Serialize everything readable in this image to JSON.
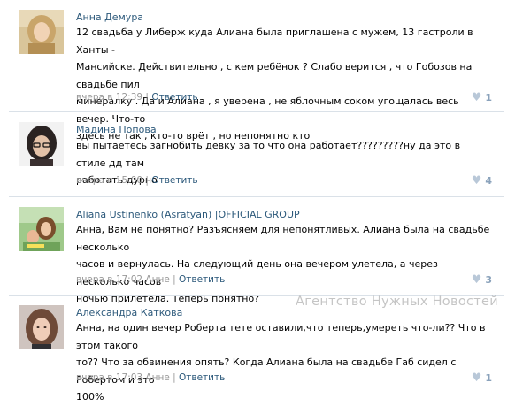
{
  "comments": [
    {
      "author": "Анна Демура",
      "lines": [
        "12 свадьба у Либерж куда Алиана была приглашена с мужем, 13 гастроли в Ханты -",
        "Мансийске. Действительно , с кем ребёнок ? Слабо верится , что Гобозов на свадьбе пил",
        "минералку . Да и Алиана , я уверена , не яблочным соком угощалась весь вечер. Что-то",
        "здесь не так , кто-то врёт , но непонятно кто"
      ],
      "time": "вчера в 12:39",
      "reply": "Ответить",
      "likes": "1"
    },
    {
      "author": "Мадина Попова",
      "lines": [
        "вы пытаетесь загнобить девку за то что она работает?????????ну да это в стиле дд там",
        "работать дурно"
      ],
      "time": "вчера в 15:00",
      "reply": "Ответить",
      "likes": "4"
    },
    {
      "author": "Aliana Ustinenko (Asratyan) |OFFICIAL GROUP",
      "lines": [
        "Анна, Вам не понятно? Разъясняем для непонятливых. Алиана была на свадьбе несколько",
        "часов и вернулась. На следующий день она вечером улетела, а через несколько часов",
        "ночью прилетела. Теперь понятно?"
      ],
      "time": "вчера в 17:02 Анне",
      "reply": "Ответить",
      "likes": "3"
    },
    {
      "author": "Александра Каткова",
      "lines": [
        "Анна, на один вечер Роберта тете оставили,что теперь,умереть что-ли?? Что в этом такого",
        "то?? Что за обвинения опять? Когда Алиана была на свадьбе Габ сидел с Робертом и это",
        "100%"
      ],
      "time": "вчера в 17:03 Анне",
      "reply": "Ответить",
      "likes": "1"
    }
  ],
  "separator": "|",
  "watermark": "Агентство Нужных Новостей",
  "colors": {
    "link": "#2b587a",
    "meta": "#999999",
    "divider": "#dae1e8",
    "heart": "#b9c8d8"
  },
  "icons": {
    "like": "heart-icon"
  }
}
